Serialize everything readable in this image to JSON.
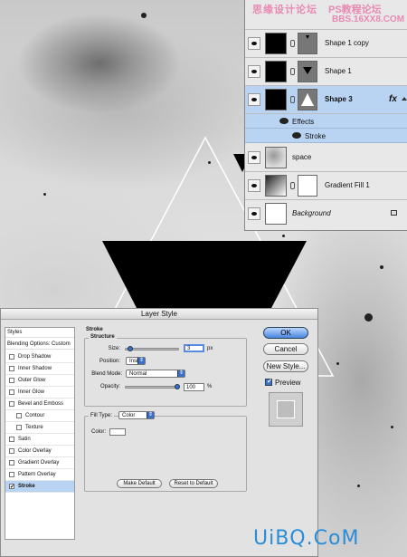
{
  "watermark_top": {
    "line1": "思缘设计论坛",
    "line2": "PS教程论坛",
    "line3": "BBS.16XX8.COM"
  },
  "watermark_bottom": "UiBQ.CoM",
  "layers_panel": {
    "layers": [
      {
        "name": "Shape 1 copy",
        "style": "normal"
      },
      {
        "name": "Shape 1",
        "style": "normal"
      },
      {
        "name": "Shape 3",
        "style": "bold",
        "selected": true,
        "fx_label": "fx"
      },
      {
        "name": "space",
        "style": "normal"
      },
      {
        "name": "Gradient Fill 1",
        "style": "normal"
      },
      {
        "name": "Background",
        "style": "italic"
      }
    ],
    "effects": {
      "label": "Effects",
      "items": [
        "Stroke"
      ]
    }
  },
  "dialog": {
    "title": "Layer Style",
    "styles_header": "Styles",
    "blending_header": "Blending Options: Custom",
    "style_items": [
      {
        "label": "Drop Shadow",
        "checked": false,
        "indent": false
      },
      {
        "label": "Inner Shadow",
        "checked": false,
        "indent": false
      },
      {
        "label": "Outer Glow",
        "checked": false,
        "indent": false
      },
      {
        "label": "Inner Glow",
        "checked": false,
        "indent": false
      },
      {
        "label": "Bevel and Emboss",
        "checked": false,
        "indent": false
      },
      {
        "label": "Contour",
        "checked": false,
        "indent": true
      },
      {
        "label": "Texture",
        "checked": false,
        "indent": true
      },
      {
        "label": "Satin",
        "checked": false,
        "indent": false
      },
      {
        "label": "Color Overlay",
        "checked": false,
        "indent": false
      },
      {
        "label": "Gradient Overlay",
        "checked": false,
        "indent": false
      },
      {
        "label": "Pattern Overlay",
        "checked": false,
        "indent": false
      },
      {
        "label": "Stroke",
        "checked": true,
        "indent": false,
        "selected": true
      }
    ],
    "stroke": {
      "section_title": "Stroke",
      "structure_title": "Structure",
      "size_label": "Size:",
      "size_value": "3",
      "size_unit": "px",
      "size_slider_fraction": 0.03,
      "position_label": "Position:",
      "position_value": "Inside",
      "blend_label": "Blend Mode:",
      "blend_value": "Normal",
      "opacity_label": "Opacity:",
      "opacity_value": "100",
      "opacity_unit": "%",
      "opacity_slider_fraction": 1.0,
      "fill_type_label": "Fill Type:",
      "fill_type_value": "Color",
      "color_label": "Color:",
      "color_value": "#ffffff"
    },
    "buttons": {
      "make_default": "Make Default",
      "reset_default": "Reset to Default",
      "ok": "OK",
      "cancel": "Cancel",
      "new_style": "New Style...",
      "preview": "Preview"
    }
  },
  "colors": {
    "selection": "#b9d3f2",
    "accent": "#3b6fc9",
    "watermark_pink": "#e88ab4",
    "watermark_blue": "#2a8dd8"
  }
}
